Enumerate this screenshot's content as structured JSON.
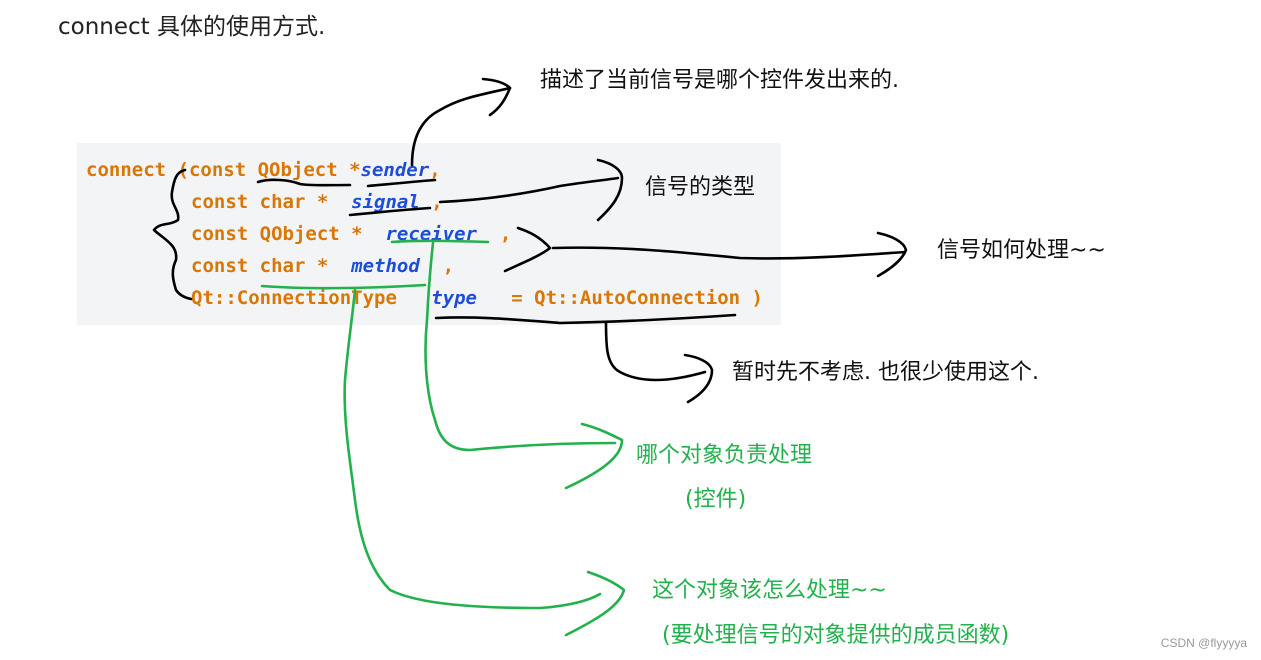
{
  "heading": "connect 具体的使用方式.",
  "code": {
    "lines": [
      {
        "prefix": "connect (const QObject *",
        "param": "sender",
        "suffix": ","
      },
      {
        "prefix": "const char *  ",
        "param": "signal",
        "suffix": " ,"
      },
      {
        "prefix": "const QObject *  ",
        "param": "receiver",
        "suffix": "  ,"
      },
      {
        "prefix": "const char *  ",
        "param": "method",
        "suffix": "  ,"
      },
      {
        "prefix": "Qt::ConnectionType   ",
        "param": "type",
        "suffix": "   = Qt::AutoConnection )"
      }
    ]
  },
  "annotations": {
    "sender": "描述了当前信号是哪个控件发出来的.",
    "signal": "信号的类型",
    "method_black": "信号如何处理~~",
    "type": "暂时先不考虑. 也很少使用这个.",
    "receiver_line1": "哪个对象负责处理",
    "receiver_line2": "(控件)",
    "method_line1": "这个对象该怎么处理~~",
    "method_line2": "(要处理信号的对象提供的成员函数)"
  },
  "colors": {
    "keyword": "#d97706",
    "param": "#1d4ed8",
    "annotation_black": "#000000",
    "annotation_green": "#22b14c",
    "code_bg": "#f3f4f6"
  },
  "watermark": "CSDN @flyyyya"
}
